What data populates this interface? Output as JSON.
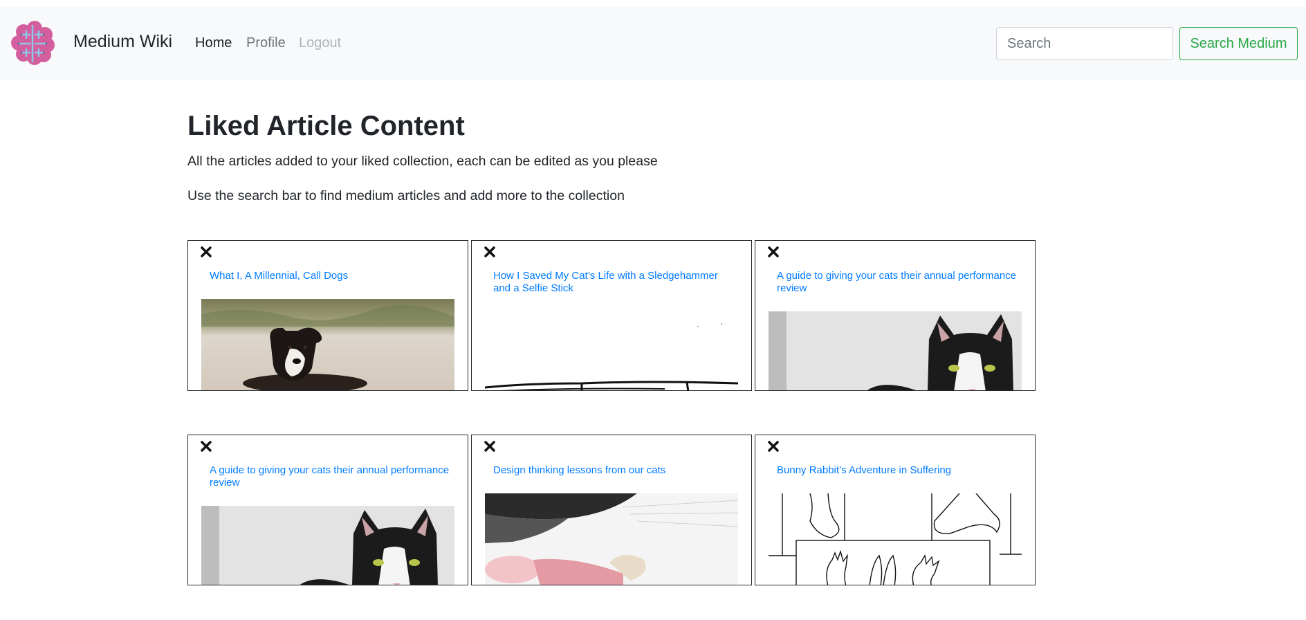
{
  "navbar": {
    "brand": "Medium Wiki",
    "logo_icon": "brain-icon",
    "links": [
      "Home",
      "Profile",
      "Logout"
    ],
    "search_placeholder": "Search",
    "search_button": "Search Medium",
    "colors": {
      "background": "#f8f9fa",
      "active": "#212529",
      "muted": "#6c757d",
      "disabled": "#adb5bd",
      "success": "#28a745"
    }
  },
  "main": {
    "title": "Liked Article Content",
    "lead1": "All the articles added to your liked collection, each can be edited as you please",
    "lead2": "Use the search bar to find medium articles and add more to the collection"
  },
  "articles": [
    {
      "title": "What I, A Millennial, Call Dogs",
      "image": "puppy-on-beach"
    },
    {
      "title": "How I Saved My Cat’s Life with a Sledgehammer and a Selfie Stick",
      "image": "line-sketch"
    },
    {
      "title": "A guide to giving your cats their annual performance review",
      "image": "black-white-cat"
    },
    {
      "title": "A guide to giving your cats their annual performance review",
      "image": "black-white-cat"
    },
    {
      "title": "Design thinking lessons from our cats",
      "image": "cat-closeup"
    },
    {
      "title": "Bunny Rabbit’s Adventure in Suffering",
      "image": "bunny-hands-sketch"
    }
  ],
  "close_icon": "close-icon",
  "link_color": "#007bff"
}
